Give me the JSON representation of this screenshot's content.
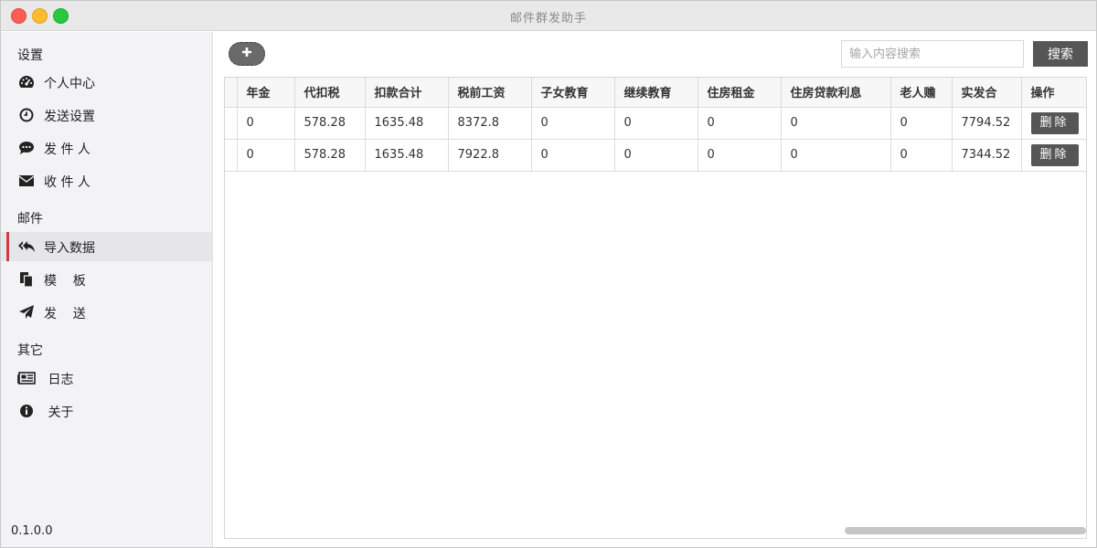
{
  "window": {
    "title": "邮件群发助手"
  },
  "sidebar": {
    "sections": [
      "设置",
      "邮件",
      "其它"
    ],
    "items": [
      {
        "label": "个人中心",
        "icon": "dashboard-icon"
      },
      {
        "label": "发送设置",
        "icon": "clock-icon"
      },
      {
        "label": "发 件 人",
        "icon": "comment-icon"
      },
      {
        "label": "收 件 人",
        "icon": "envelope-icon"
      },
      {
        "label": "导入数据",
        "icon": "reply-all-icon",
        "active": true
      },
      {
        "label": "模    板",
        "icon": "copy-icon"
      },
      {
        "label": "发    送",
        "icon": "paper-plane-icon"
      },
      {
        "label": " 日志",
        "icon": "newspaper-icon"
      },
      {
        "label": " 关于",
        "icon": "info-icon"
      }
    ],
    "version": "0.1.0.0"
  },
  "toolbar": {
    "add_icon": "plus-icon",
    "search_placeholder": "输入内容搜索",
    "search_label": "搜索"
  },
  "table": {
    "columns": [
      "年金",
      "代扣税",
      "扣款合计",
      "税前工资",
      "子女教育",
      "继续教育",
      "住房租金",
      "住房贷款利息",
      "老人赡",
      "实发合",
      "操作"
    ],
    "rows": [
      [
        "0",
        "578.28",
        "1635.48",
        "8372.8",
        "0",
        "0",
        "0",
        "0",
        "0",
        "7794.52"
      ],
      [
        "0",
        "578.28",
        "1635.48",
        "7922.8",
        "0",
        "0",
        "0",
        "0",
        "0",
        "7344.52"
      ]
    ],
    "delete_label": "删除"
  },
  "colors": {
    "accent": "#d03b3b",
    "button": "#565656"
  }
}
